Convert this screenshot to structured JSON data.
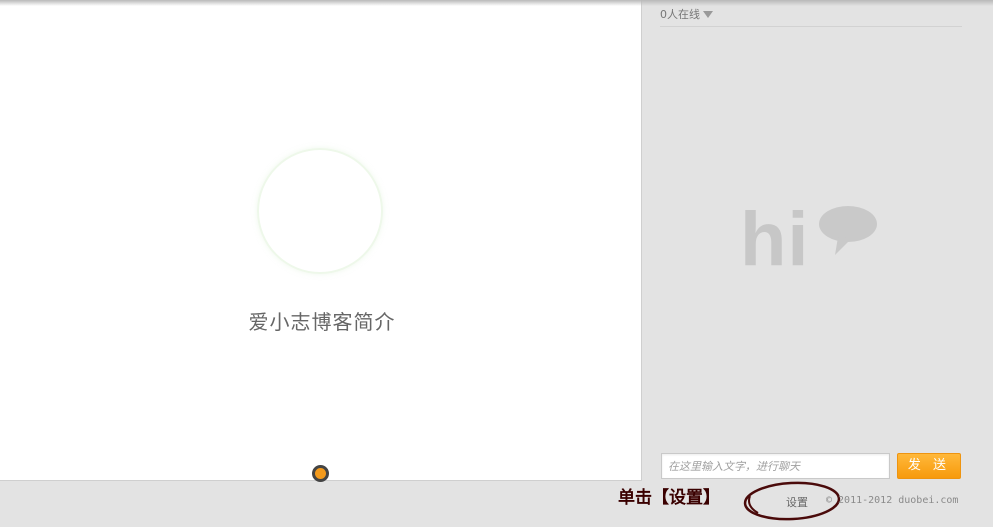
{
  "presentation": {
    "title": "爱小志博客简介"
  },
  "chat": {
    "online_count": "0人在线",
    "hi_text": "hi",
    "input_placeholder": "在这里输入文字，进行聊天",
    "send_label": "发 送"
  },
  "footer": {
    "annotation": "单击【设置】",
    "settings_label": "设置",
    "copyright": "© 2011-2012 duobei.com"
  },
  "colors": {
    "send_button": "#f79a0c",
    "progress_dot": "#f39a1c",
    "annotation": "#3a0000",
    "ellipse_stroke": "#4a0a0a"
  },
  "icons": {
    "online_dropdown": "caret-down-icon",
    "speech": "speech-bubble-icon"
  }
}
